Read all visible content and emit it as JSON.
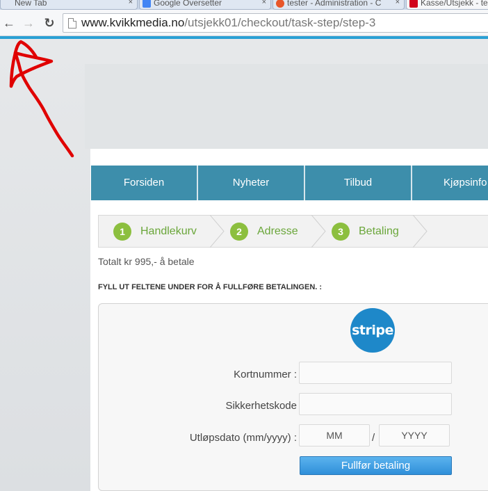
{
  "browser": {
    "tabs": [
      {
        "title": "New Tab",
        "icon": "new-tab-icon",
        "close": "×"
      },
      {
        "title": "Google Oversetter",
        "icon": "google-translate-icon",
        "close": "×"
      },
      {
        "title": "tester - Administration - C",
        "icon": "joomla-icon",
        "close": "×"
      },
      {
        "title": "Kasse/Utsjekk - te",
        "icon": "site-favicon",
        "close": ""
      }
    ],
    "back_glyph": "←",
    "forward_glyph": "→",
    "reload_glyph": "↻",
    "url_host": "www.kvikkmedia.no",
    "url_path": "/utsjekk01/checkout/task-step/step-3",
    "accent_color": "#2aa0d4"
  },
  "nav": {
    "items": [
      "Forsiden",
      "Nyheter",
      "Tilbud",
      "Kjøpsinfo"
    ],
    "color": "#3d8eab"
  },
  "steps": [
    {
      "num": "1",
      "label": "Handlekurv"
    },
    {
      "num": "2",
      "label": "Adresse"
    },
    {
      "num": "3",
      "label": "Betaling"
    }
  ],
  "checkout": {
    "total": "Totalt kr 995,- å betale",
    "instructions": "FYLL UT FELTENE UNDER FOR Å FULLFØRE BETALINGEN. :",
    "logo_text": "stripe",
    "card_label": "Kortnummer :",
    "card_value": "",
    "cvc_label": "Sikkerhetskode",
    "cvc_value": "",
    "expiry_label": "Utløpsdato (mm/yyyy) :",
    "month_placeholder": "MM",
    "year_placeholder": "YYYY",
    "slash": "/",
    "submit_label": "Fullfør betaling",
    "step_color": "#8cbf3f",
    "button_color": "#2f8fd9"
  }
}
